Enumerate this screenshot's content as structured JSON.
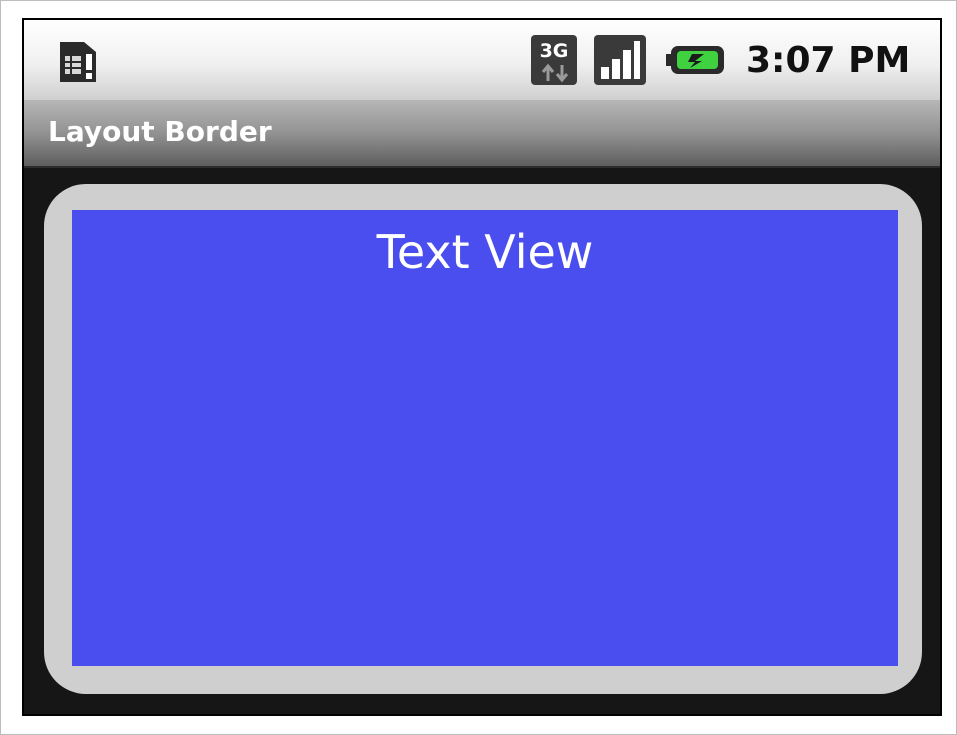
{
  "status_bar": {
    "network_type": "3G",
    "time": "3:07 PM",
    "icons": [
      "sim-alert-icon",
      "3g-data-icon",
      "signal-strength-icon",
      "battery-charging-icon"
    ]
  },
  "title_bar": {
    "title": "Layout Border"
  },
  "content": {
    "text_view_label": "Text View",
    "colors": {
      "border": "#cfcfcf",
      "view_background": "#4a4eee",
      "screen_background": "#161616"
    }
  }
}
